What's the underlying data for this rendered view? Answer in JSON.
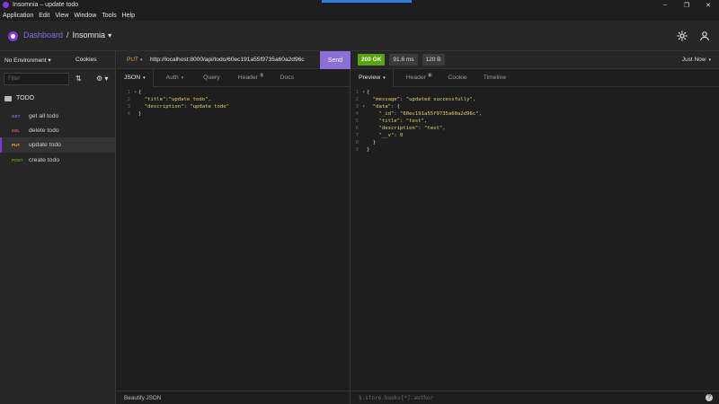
{
  "window": {
    "title": "Insomnia – update todo",
    "minimize": "–",
    "maximize": "❐",
    "close": "✕"
  },
  "menu": [
    "Application",
    "Edit",
    "View",
    "Window",
    "Tools",
    "Help"
  ],
  "header": {
    "dashboard": "Dashboard",
    "separator": "/",
    "project": "Insomnia"
  },
  "sidebar": {
    "environment": "No Environment ▾",
    "cookies": "Cookies",
    "filter_placeholder": "Filter",
    "folder": "TODO",
    "items": [
      {
        "method": "GET",
        "name": "get all todo",
        "color": "#7d69cb"
      },
      {
        "method": "DEL",
        "name": "delete todo",
        "color": "#e15251"
      },
      {
        "method": "PUT",
        "name": "update todo",
        "color": "#e7a23c"
      },
      {
        "method": "POST",
        "name": "create todo",
        "color": "#59a210"
      }
    ]
  },
  "request": {
    "method": "PUT",
    "url": "http://localhost:8000/api/todo/60ec191a55f9735a60a2d96c",
    "send_label": "Send",
    "tabs": {
      "body": "JSON",
      "auth": "Auth",
      "query": "Query",
      "header": "Header",
      "header_count": "1",
      "docs": "Docs"
    },
    "body_lines": [
      "{",
      "  \"title\":\"update todo\",",
      "  \"description\": \"update todo\"",
      "}"
    ],
    "footer": "Beautify JSON"
  },
  "response": {
    "status": "200 OK",
    "time": "91.6 ms",
    "size": "120 B",
    "timestamp": "Just Now",
    "tabs": {
      "preview": "Preview",
      "header": "Header",
      "header_count": "6",
      "cookie": "Cookie",
      "timeline": "Timeline"
    },
    "body_lines": [
      "{",
      "  \"message\": \"updated successfully\",",
      "  \"data\": {",
      "    \"_id\": \"60ec191a55f9735a60a2d96c\",",
      "    \"title\": \"test\",",
      "    \"description\": \"test\",",
      "    \"__v\": 0",
      "  }",
      "}"
    ],
    "footer_filter": "$.store.books[*].author",
    "help": "?"
  }
}
